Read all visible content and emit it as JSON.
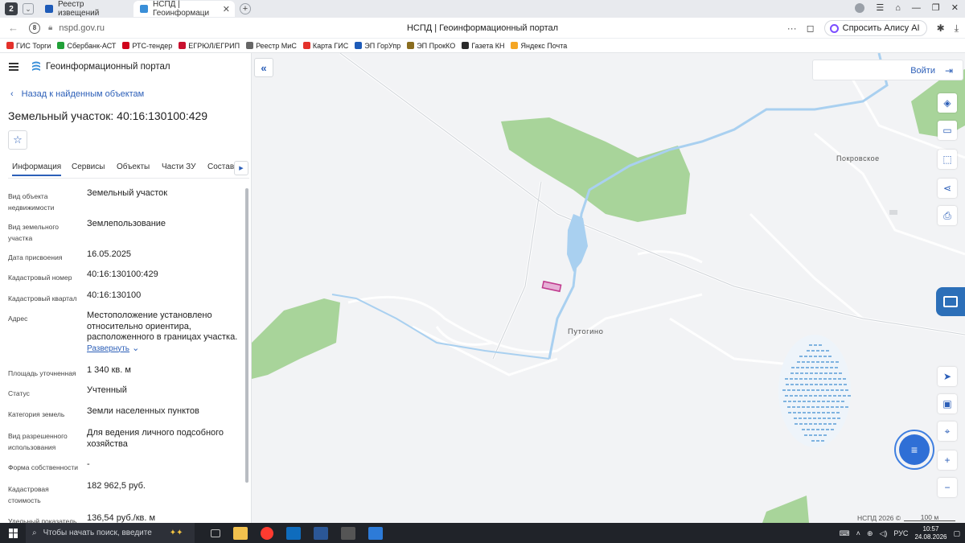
{
  "browser": {
    "tab_counter": "2",
    "tabs": [
      {
        "label": "Реестр извещений",
        "active": false
      },
      {
        "label": "НСПД | Геоинформаци",
        "active": true
      }
    ],
    "url": "nspd.gov.ru",
    "page_title": "НСПД | Геоинформационный портал",
    "alice_label": "Спросить Алису AI"
  },
  "bookmarks": [
    {
      "label": "ГИС Торги",
      "color": "#e4312b"
    },
    {
      "label": "Сбербанк-АСТ",
      "color": "#21a038"
    },
    {
      "label": "РТС-тендер",
      "color": "#d0021b"
    },
    {
      "label": "ЕГРЮЛ/ЕГРИП",
      "color": "#c8102e"
    },
    {
      "label": "Реестр МиС",
      "color": "#666666"
    },
    {
      "label": "Карта ГИС",
      "color": "#e4312b"
    },
    {
      "label": "ЭП ГорУпр",
      "color": "#1e5bb8"
    },
    {
      "label": "ЭП ПрокКО",
      "color": "#8a6d1f"
    },
    {
      "label": "Газета КН",
      "color": "#2a2a2a"
    },
    {
      "label": "Яндекс Почта",
      "color": "#f5a623"
    }
  ],
  "panel": {
    "portal_name": "Геоинформационный портал",
    "back_label": "Назад к найденным объектам",
    "object_title": "Земельный участок: 40:16:130100:429",
    "tabs": [
      "Информация",
      "Сервисы",
      "Объекты",
      "Части ЗУ",
      "Состав"
    ],
    "properties": [
      {
        "label": "Вид объекта недвижимости",
        "value": "Земельный участок"
      },
      {
        "label": "Вид земельного участка",
        "value": "Землепользование"
      },
      {
        "label": "Дата присвоения",
        "value": "16.05.2025"
      },
      {
        "label": "Кадастровый номер",
        "value": "40:16:130100:429"
      },
      {
        "label": "Кадастровый квартал",
        "value": "40:16:130100"
      },
      {
        "label": "Адрес",
        "value": "Местоположение установлено относительно ориентира, расположенного в границах участка.",
        "more": "Развернуть"
      },
      {
        "label": "Площадь уточненная",
        "value": "1 340 кв. м"
      },
      {
        "label": "Статус",
        "value": "Учтенный"
      },
      {
        "label": "Категория земель",
        "value": "Земли населенных пунктов"
      },
      {
        "label": "Вид разрешенного использования",
        "value": "Для ведения личного подсобного хозяйства"
      },
      {
        "label": "Форма собственности",
        "value": "-"
      },
      {
        "label": "Кадастровая стоимость",
        "value": "182 962,5 руб."
      },
      {
        "label": "Удельный показатель",
        "value": "136,54 руб./кв. м"
      }
    ]
  },
  "map": {
    "login_label": "Войти",
    "places": [
      "Покровское",
      "Путогино"
    ],
    "credit": "НСПД 2026 ©",
    "scale": "100 м"
  },
  "taskbar": {
    "search_placeholder": "Чтобы начать поиск, введите",
    "lang": "РУС",
    "time": "10:57",
    "date": "24.08.2026"
  },
  "colors": {
    "accent": "#2c5fb8",
    "forest": "#a8d49a",
    "water": "#a9d0f0",
    "parcel": "#c0398d"
  }
}
